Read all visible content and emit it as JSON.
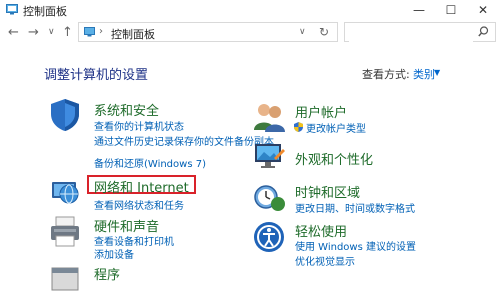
{
  "window": {
    "title": "控制面板",
    "minimize_glyph": "—",
    "maximize_glyph": "☐",
    "close_glyph": "✕"
  },
  "nav": {
    "back_glyph": "←",
    "forward_glyph": "→",
    "history_glyph": "∨",
    "up_glyph": "↑",
    "breadcrumb_sep": "›",
    "breadcrumb": "控制面板",
    "dropdown_glyph": "∨",
    "refresh_glyph": "↻"
  },
  "search": {
    "placeholder": ""
  },
  "main": {
    "heading": "调整计算机的设置",
    "view_by_label": "查看方式:",
    "view_by_value": "类别",
    "view_dd_glyph": "▼"
  },
  "categories_left": [
    {
      "title": "系统和安全",
      "links": [
        "查看你的计算机状态",
        "通过文件历史记录保存你的文件备份副本",
        "备份和还原(Windows 7)"
      ]
    },
    {
      "title": "网络和 Internet",
      "links": [
        "查看网络状态和任务"
      ]
    },
    {
      "title": "硬件和声音",
      "links": [
        "查看设备和打印机",
        "添加设备"
      ]
    },
    {
      "title": "程序",
      "links": []
    }
  ],
  "categories_right": [
    {
      "title": "用户帐户",
      "links": [
        "更改帐户类型"
      ]
    },
    {
      "title": "外观和个性化",
      "links": []
    },
    {
      "title": "时钟和区域",
      "links": [
        "更改日期、时间或数字格式"
      ]
    },
    {
      "title": "轻松使用",
      "links": [
        "使用 Windows 建议的设置",
        "优化视觉显示"
      ]
    }
  ],
  "colors": {
    "heading": "#1e3287",
    "category_title": "#1e6b2a",
    "link": "#0060b5",
    "highlight_border": "#d9222a"
  }
}
